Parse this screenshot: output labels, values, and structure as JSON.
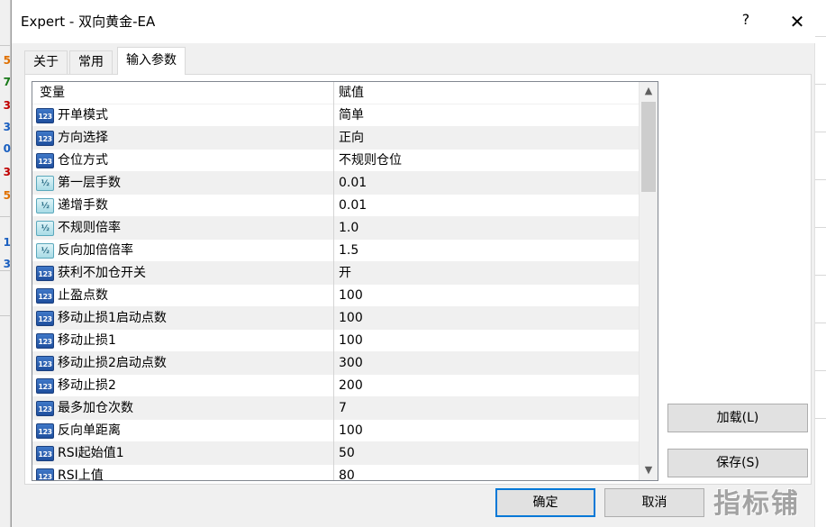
{
  "background_strip": {
    "digits": [
      {
        "text": "5",
        "color": "#e07000"
      },
      {
        "text": "7",
        "color": "#1a7a1a"
      },
      {
        "text": "3",
        "color": "#c00000"
      },
      {
        "text": "3",
        "color": "#1a5fc0"
      },
      {
        "text": "0",
        "color": "#1a5fc0"
      },
      {
        "text": "3",
        "color": "#c00000"
      },
      {
        "text": "5",
        "color": "#e07000"
      },
      {
        "text": "1",
        "color": "#1a5fc0"
      },
      {
        "text": "3",
        "color": "#1a5fc0"
      }
    ]
  },
  "window": {
    "title": "Expert - 双向黄金-EA",
    "help": "?",
    "close": "✕"
  },
  "tabs": [
    {
      "label": "关于",
      "active": false
    },
    {
      "label": "常用",
      "active": false
    },
    {
      "label": "输入参数",
      "active": true
    }
  ],
  "grid": {
    "headers": {
      "variable": "变量",
      "value": "赋值"
    },
    "rows": [
      {
        "icon": "123",
        "type": "int",
        "name": "开单模式",
        "value": "简单"
      },
      {
        "icon": "123",
        "type": "int",
        "name": "方向选择",
        "value": "正向"
      },
      {
        "icon": "123",
        "type": "int",
        "name": "仓位方式",
        "value": "不规则仓位"
      },
      {
        "icon": "½",
        "type": "dbl",
        "name": "第一层手数",
        "value": "0.01"
      },
      {
        "icon": "½",
        "type": "dbl",
        "name": "递增手数",
        "value": "0.01"
      },
      {
        "icon": "½",
        "type": "dbl",
        "name": "不规则倍率",
        "value": "1.0"
      },
      {
        "icon": "½",
        "type": "dbl",
        "name": "反向加倍倍率",
        "value": "1.5"
      },
      {
        "icon": "123",
        "type": "int",
        "name": "获利不加仓开关",
        "value": "开"
      },
      {
        "icon": "123",
        "type": "int",
        "name": "止盈点数",
        "value": "100"
      },
      {
        "icon": "123",
        "type": "int",
        "name": "移动止损1启动点数",
        "value": "100"
      },
      {
        "icon": "123",
        "type": "int",
        "name": "移动止损1",
        "value": "100"
      },
      {
        "icon": "123",
        "type": "int",
        "name": "移动止损2启动点数",
        "value": "300"
      },
      {
        "icon": "123",
        "type": "int",
        "name": "移动止损2",
        "value": "200"
      },
      {
        "icon": "123",
        "type": "int",
        "name": "最多加仓次数",
        "value": "7"
      },
      {
        "icon": "123",
        "type": "int",
        "name": "反向单距离",
        "value": "100"
      },
      {
        "icon": "123",
        "type": "int",
        "name": "RSI起始值1",
        "value": "50"
      },
      {
        "icon": "123",
        "type": "int",
        "name": "RSI上值",
        "value": "80"
      }
    ]
  },
  "scrollbar": {
    "up": "▲",
    "down": "▼"
  },
  "buttons": {
    "load": "加载(L)",
    "save": "保存(S)",
    "ok": "确定",
    "cancel": "取消"
  },
  "watermark": "指标铺"
}
